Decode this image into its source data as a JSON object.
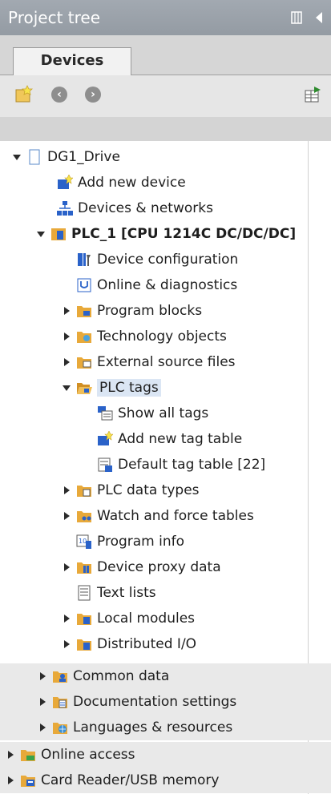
{
  "header": {
    "title": "Project tree"
  },
  "tabs": [
    {
      "label": "Devices"
    }
  ],
  "colors": {
    "titlebar": "#9aa1a9",
    "folder": "#e8a93a",
    "device_blue": "#2a62c9",
    "selection": "#dbe6f4"
  },
  "tree": {
    "project": {
      "label": "DG1_Drive",
      "icon": "project-icon"
    },
    "add_new_device": {
      "label": "Add new device",
      "icon": "add-device-icon"
    },
    "devices_networks": {
      "label": "Devices & networks",
      "icon": "network-icon"
    },
    "plc": {
      "label": "PLC_1 [CPU 1214C DC/DC/DC]",
      "icon": "plc-icon"
    },
    "device_configuration": {
      "label": "Device configuration",
      "icon": "device-config-icon"
    },
    "online_diagnostics": {
      "label": "Online & diagnostics",
      "icon": "diagnostics-icon"
    },
    "program_blocks": {
      "label": "Program blocks",
      "icon": "folder-icon"
    },
    "technology_objects": {
      "label": "Technology objects",
      "icon": "folder-icon"
    },
    "external_source_files": {
      "label": "External source files",
      "icon": "folder-icon"
    },
    "plc_tags": {
      "label": "PLC tags",
      "icon": "folder-open-icon"
    },
    "show_all_tags": {
      "label": "Show all tags",
      "icon": "tags-icon"
    },
    "add_new_tag_table": {
      "label": "Add new tag table",
      "icon": "add-table-icon"
    },
    "default_tag_table": {
      "label": "Default tag table [22]",
      "icon": "tag-table-icon"
    },
    "plc_data_types": {
      "label": "PLC data types",
      "icon": "folder-icon"
    },
    "watch_force_tables": {
      "label": "Watch and force tables",
      "icon": "folder-icon"
    },
    "program_info": {
      "label": "Program info",
      "icon": "program-info-icon"
    },
    "device_proxy_data": {
      "label": "Device proxy data",
      "icon": "folder-icon"
    },
    "text_lists": {
      "label": "Text lists",
      "icon": "text-list-icon"
    },
    "local_modules": {
      "label": "Local modules",
      "icon": "folder-icon"
    },
    "distributed_io": {
      "label": "Distributed I/O",
      "icon": "folder-icon"
    },
    "common_data": {
      "label": "Common data",
      "icon": "folder-icon"
    },
    "documentation_settings": {
      "label": "Documentation settings",
      "icon": "folder-icon"
    },
    "languages_resources": {
      "label": "Languages & resources",
      "icon": "folder-icon"
    },
    "online_access": {
      "label": "Online access",
      "icon": "folder-icon"
    },
    "card_reader": {
      "label": "Card Reader/USB memory",
      "icon": "folder-icon"
    }
  }
}
